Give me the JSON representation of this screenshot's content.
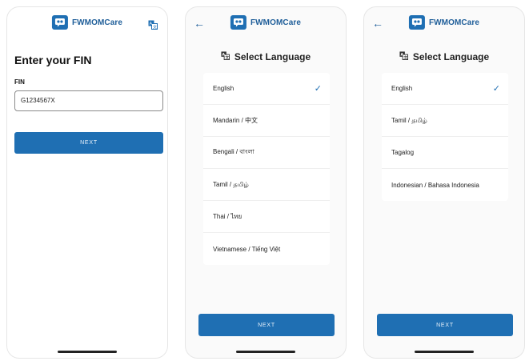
{
  "brand": {
    "name": "FWMOMCare"
  },
  "screen1": {
    "title": "Enter your FIN",
    "fin_label": "FIN",
    "fin_value": "G1234567X",
    "next_label": "NEXT"
  },
  "screen2": {
    "title": "Select Language",
    "languages": [
      {
        "label": "English",
        "selected": true
      },
      {
        "label": "Mandarin / 中文",
        "selected": false
      },
      {
        "label": "Bengali / বাংলা",
        "selected": false
      },
      {
        "label": "Tamil / தமிழ்",
        "selected": false
      },
      {
        "label": "Thai / ไทย",
        "selected": false
      },
      {
        "label": "Vietnamese / Tiếng Việt",
        "selected": false
      }
    ],
    "next_label": "NEXT"
  },
  "screen3": {
    "title": "Select Language",
    "languages": [
      {
        "label": "English",
        "selected": true
      },
      {
        "label": "Tamil / தமிழ்",
        "selected": false
      },
      {
        "label": "Tagalog",
        "selected": false
      },
      {
        "label": "Indonesian / Bahasa Indonesia",
        "selected": false
      }
    ],
    "next_label": "NEXT"
  },
  "icons": {
    "logo": "chat-people-icon",
    "translate": "translate-icon",
    "back": "arrow-left-icon",
    "check": "check-icon"
  },
  "colors": {
    "primary": "#1f6fb3",
    "brand_text": "#1f5e99"
  }
}
